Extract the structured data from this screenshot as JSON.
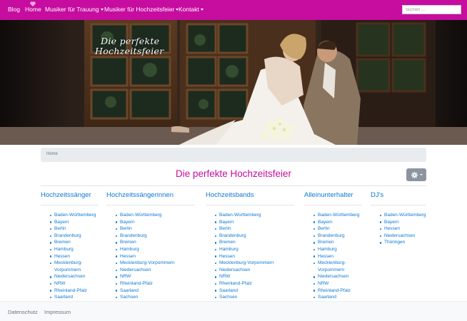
{
  "nav": {
    "items": [
      {
        "label": "Blog"
      },
      {
        "label": "Home"
      },
      {
        "label": "Musiker für Trauung"
      },
      {
        "label": "Musiker für Hochzeitsfeier"
      },
      {
        "label": "Kontakt"
      }
    ],
    "search_placeholder": "Suchen ..."
  },
  "hero": {
    "title_line1": "Die perfekte",
    "title_line2": "Hochzeitsfeier"
  },
  "breadcrumb": {
    "home": "Home"
  },
  "page_title": "Die perfekte Hochzeitsfeier",
  "columns": [
    {
      "title": "Hochzeitssänger",
      "items": [
        "Baden-Württemberg",
        "Bayern",
        "Berlin",
        "Brandenburg",
        "Bremen",
        "Hamburg",
        "Hessen",
        "Mecklenburg-",
        "Vorpommern",
        "Niedersachsen",
        "NRW",
        "Rheinland-Pfalz",
        "Saarland"
      ]
    },
    {
      "title": "Hochzeitssängerinnen",
      "items": [
        "Baden-Württemberg",
        "Bayern",
        "Berlin",
        "Brandenburg",
        "Bremen",
        "Hamburg",
        "Hessen",
        "Mecklenburg-Vorpommern",
        "Niedersachsen",
        "NRW",
        "Rheinland-Pfalz",
        "Saarland",
        "Sachsen"
      ]
    },
    {
      "title": "Hochzeitsbands",
      "items": [
        "Baden-Württemberg",
        "Bayern",
        "Berlin",
        "Brandenburg",
        "Bremen",
        "Hamburg",
        "Hessen",
        "Mecklenburg-Vorpommern",
        "Niedersachsen",
        "NRW",
        "Rheinland-Pfalz",
        "Saarland",
        "Sachsen"
      ]
    },
    {
      "title": "Alleinunterhalter",
      "items": [
        "Baden-Württemberg",
        "Bayern",
        "Berlin",
        "Brandenburg",
        "Bremen",
        "Hamburg",
        "Hessen",
        "Mecklenburg-",
        "Vorpommern",
        "Niedersachsen",
        "NRW",
        "Rheinland-Pfalz",
        "Saarland"
      ]
    },
    {
      "title": "DJ's",
      "items": [
        "Baden-Württemberg",
        "Bayern",
        "Hessen",
        "Niedersachsen",
        "Thüringen"
      ]
    }
  ],
  "footer": {
    "datenschutz": "Datenschutz",
    "impressum": "Impressum"
  },
  "colors": {
    "brand": "#c60da0",
    "link": "#0d78d4"
  }
}
